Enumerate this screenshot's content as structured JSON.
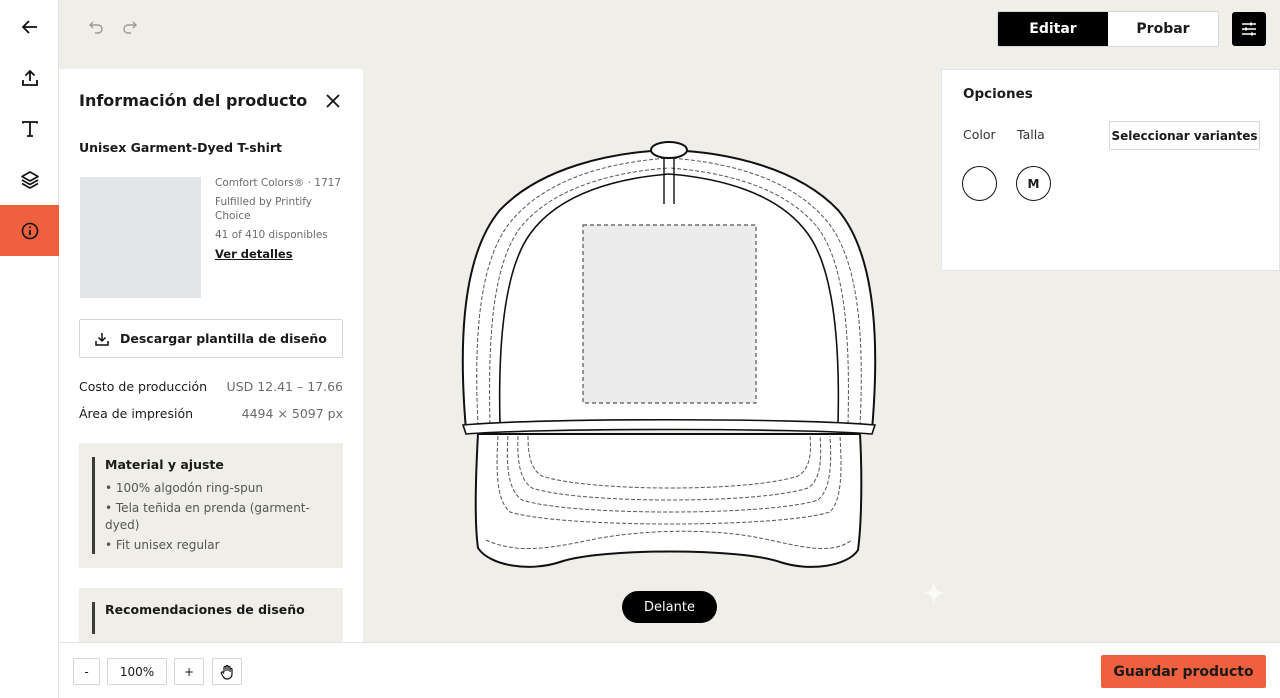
{
  "toolbar": {
    "rail_icons": [
      "back-arrow-icon",
      "upload-icon",
      "text-icon",
      "layers-icon",
      "info-icon"
    ],
    "mode_edit": "Editar",
    "mode_try": "Probar"
  },
  "panel": {
    "title": "Información del producto",
    "product_name": "Unisex Garment-Dyed T-shirt",
    "brand": "Comfort Colors® · 1717",
    "fulfilled": "Fulfilled by Printify Choice",
    "availability": "41 of 410 disponibles",
    "details_link": "Ver detalles",
    "download_label": "Descargar plantilla de diseño",
    "cost_label": "Costo de producción",
    "cost_value": "USD 12.41 – 17.66",
    "print_area_label": "Área de impresión",
    "print_area_value": "4494 × 5097 px",
    "material": {
      "title": "Material y ajuste",
      "items": [
        "• 100% algodón ring-spun",
        "• Tela teñida en prenda (garment-dyed)",
        "• Fit unisex regular"
      ]
    },
    "recommendations_title": "Recomendaciones de diseño"
  },
  "canvas": {
    "view_label": "Delante"
  },
  "options": {
    "title": "Opciones",
    "color_label": "Color",
    "size_label": "Talla",
    "variants_button": "Seleccionar variantes",
    "selected_color": "#ffffff",
    "selected_size": "M"
  },
  "bottom": {
    "zoom_out": "-",
    "zoom_level": "100%",
    "zoom_in": "+",
    "save_label": "Guardar producto"
  },
  "colors": {
    "accent": "#f0603e",
    "background": "#efeee8"
  }
}
